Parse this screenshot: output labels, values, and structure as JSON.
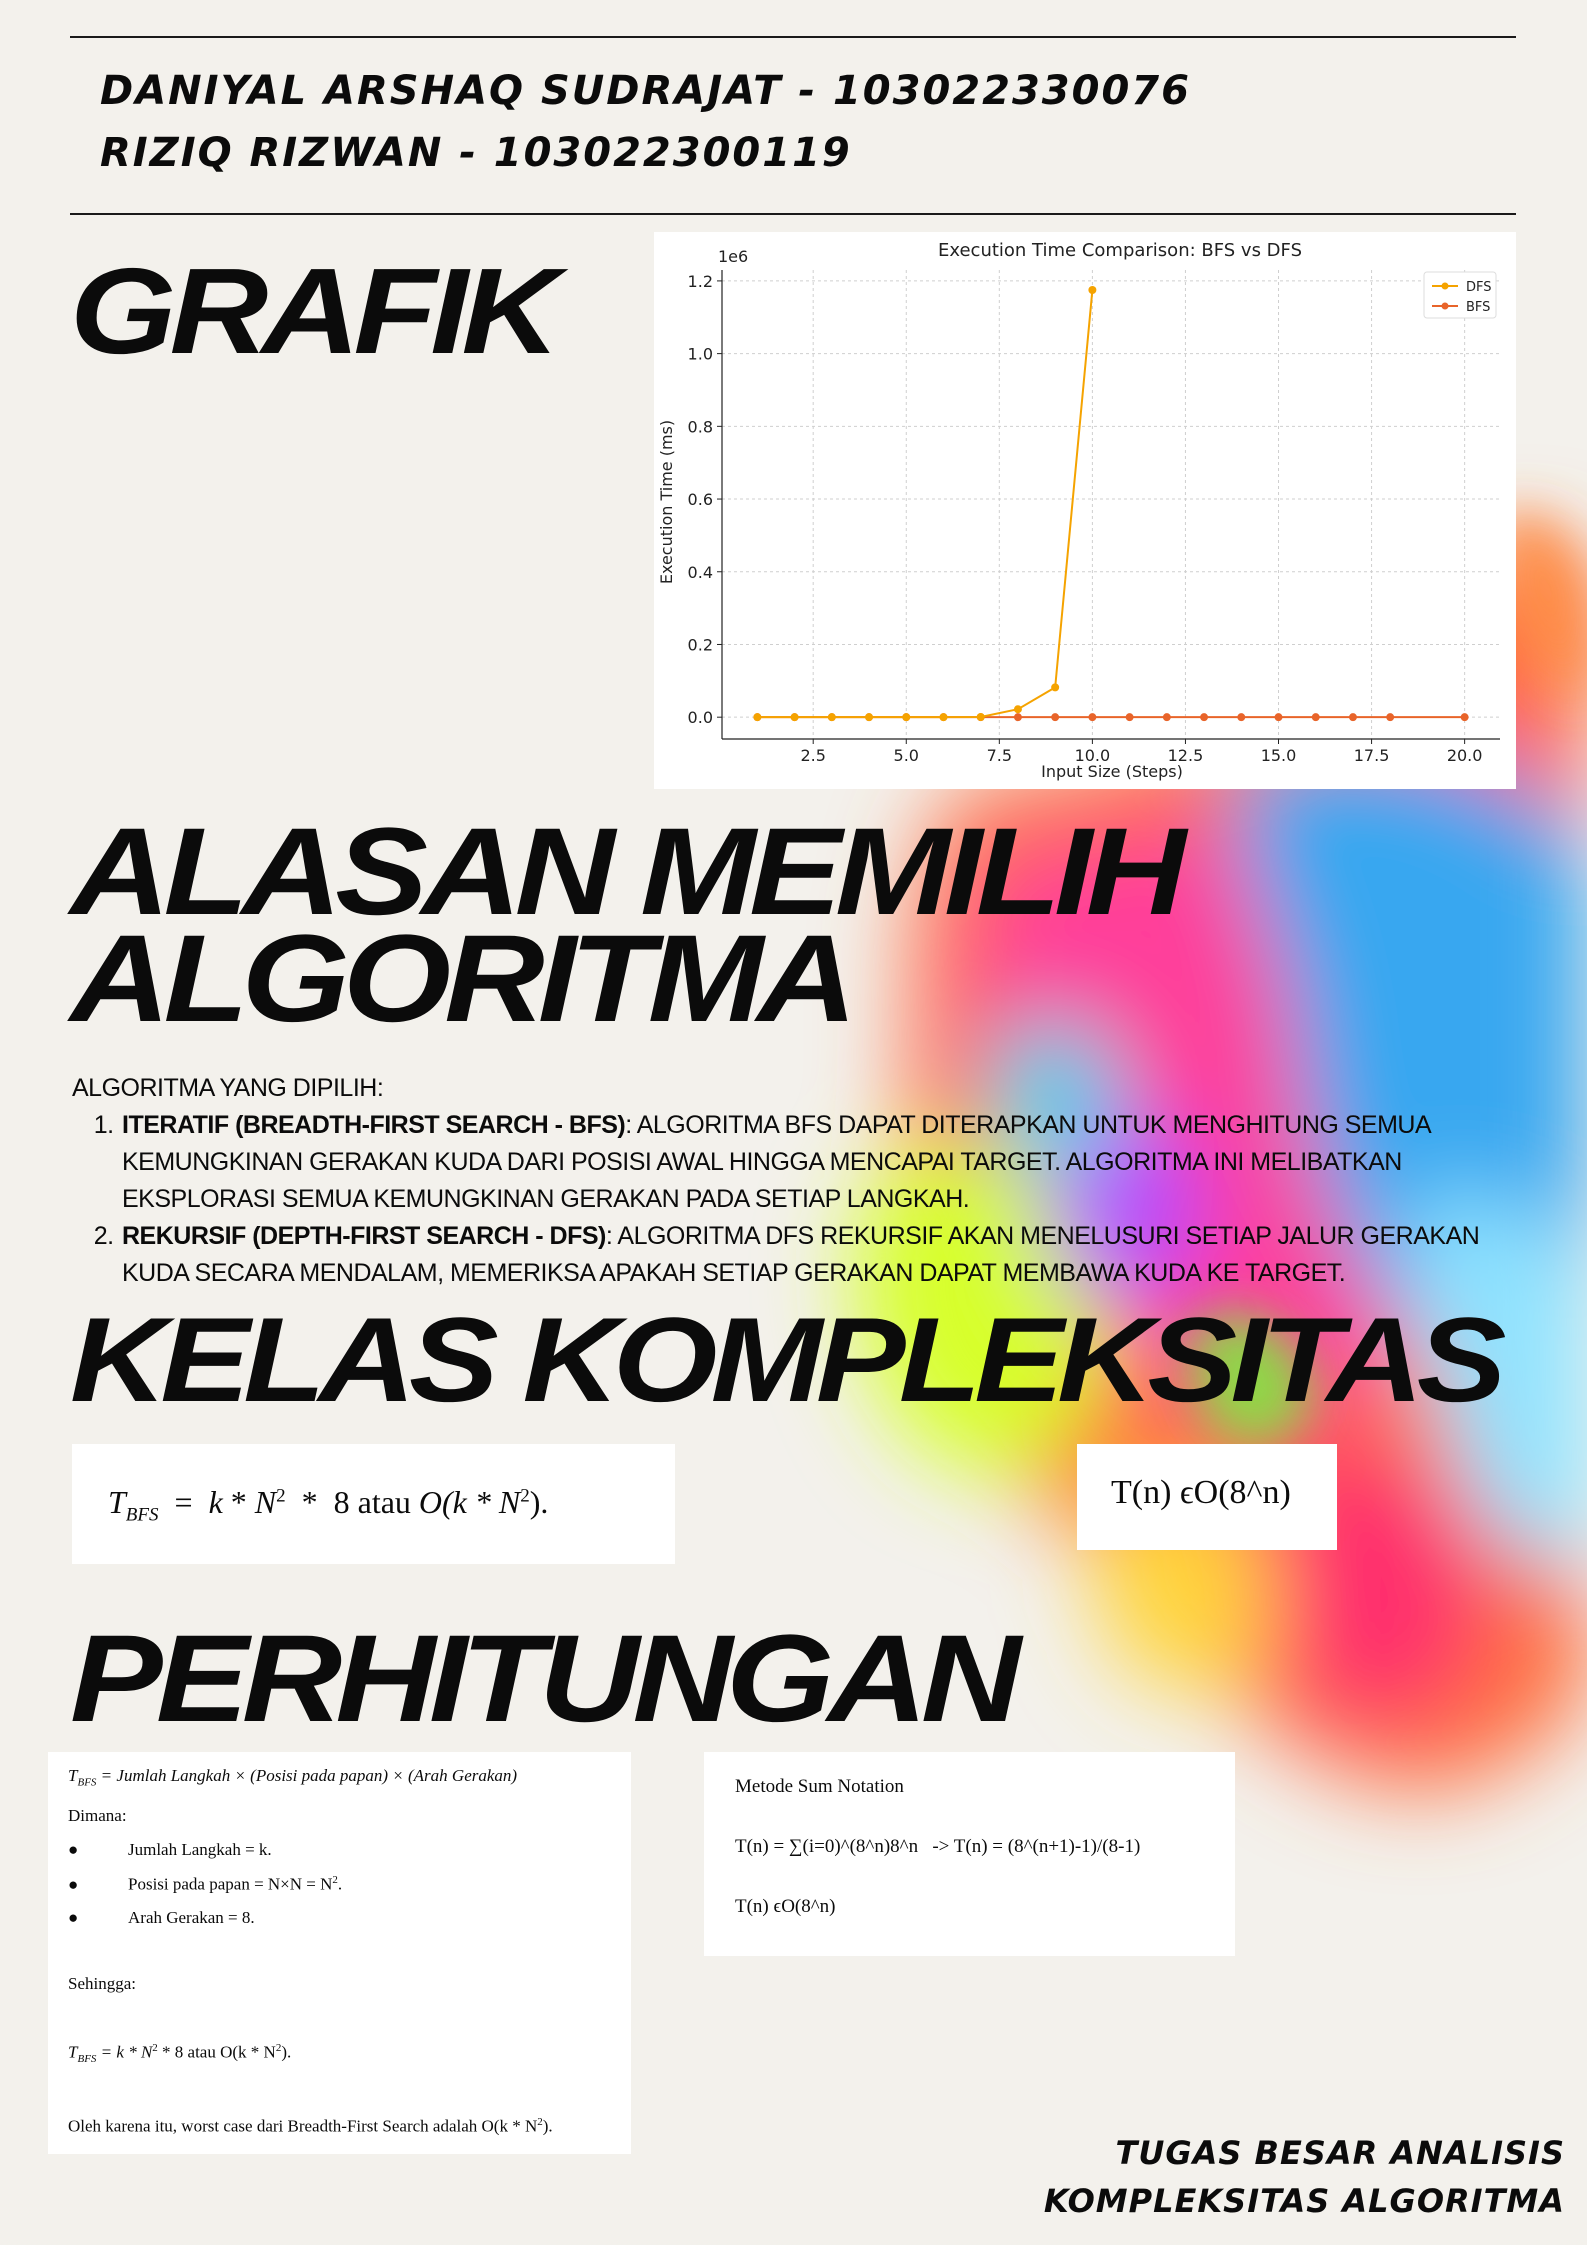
{
  "authors": [
    "DANIYAL ARSHAQ SUDRAJAT - 103022330076",
    "RIZIQ RIZWAN - 103022300119"
  ],
  "sections": {
    "grafik": "GRAFIK",
    "alasan_line1": "ALASAN MEMILIH",
    "alasan_line2": "ALGORITMA",
    "kelas": "KELAS KOMPLEKSITAS",
    "perhitungan": "PERHITUNGAN"
  },
  "algorithms": {
    "intro": "ALGORITMA YANG DIPILIH:",
    "items": [
      {
        "title": "ITERATIF (BREADTH-FIRST SEARCH - BFS)",
        "text": ": ALGORITMA BFS DAPAT DITERAPKAN UNTUK MENGHITUNG SEMUA KEMUNGKINAN GERAKAN KUDA DARI POSISI AWAL HINGGA MENCAPAI TARGET. ALGORITMA INI MELIBATKAN EKSPLORASI SEMUA KEMUNGKINAN GERAKAN PADA SETIAP LANGKAH."
      },
      {
        "title": "REKURSIF (DEPTH-FIRST SEARCH - DFS)",
        "text": ": ALGORITMA DFS REKURSIF AKAN MENELUSURI SETIAP JALUR GERAKAN KUDA SECARA MENDALAM, MEMERIKSA APAKAH SETIAP GERAKAN DAPAT MEMBAWA KUDA KE TARGET."
      }
    ]
  },
  "complexity": {
    "bfs": {
      "t": "T",
      "sub": "BFS",
      "eq": "=",
      "k": "k",
      "star": "*",
      "n": "N",
      "exp": "2",
      "eight": "8 atau",
      "o_open": "O(k * N",
      "o_close": ")."
    },
    "dfs": "T(n) ϵO(8^n)"
  },
  "perhitungan_bfs": {
    "formula_lhs": "T",
    "formula_sub": "BFS",
    "formula_rhs": "=  Jumlah Langkah × (Posisi pada papan) × (Arah Gerakan)",
    "dimana": "Dimana:",
    "bullets": [
      {
        "text": "Jumlah Langkah = k.",
        "sup": ""
      },
      {
        "text": "Posisi pada papan = N×N  =  N",
        "sup": "2",
        "tail": "."
      },
      {
        "text": "Arah Gerakan = 8.",
        "sup": ""
      }
    ],
    "sehingga": "Sehingga:",
    "result_lhs": "T",
    "result_sub": "BFS",
    "result_body": "=  k * N",
    "result_exp": "2",
    "result_tail": "  *  8 atau O(k * N",
    "result_exp2": "2",
    "result_end": ").",
    "conclusion": "Oleh karena itu, worst case dari Breadth-First Search adalah O(k * N",
    "conclusion_exp": "2",
    "conclusion_end": ")."
  },
  "perhitungan_dfs": {
    "title": "Metode Sum Notation",
    "line1": "T(n) = ∑(i=0)^(8^n)8^n   -> T(n) = (8^(n+1)-1)/(8-1)",
    "line2": "T(n) ϵO(8^n)"
  },
  "footer": [
    "TUGAS BESAR ANALISIS",
    "KOMPLEKSITAS ALGORITMA"
  ],
  "chart_data": {
    "type": "line",
    "title": "Execution Time Comparison: BFS vs DFS",
    "xlabel": "Input Size (Steps)",
    "ylabel": "Execution Time (ms)",
    "y_multiplier_label": "1e6",
    "xlim": [
      0.05,
      20.95
    ],
    "ylim": [
      -60000,
      1230000
    ],
    "xticks": [
      2.5,
      5.0,
      7.5,
      10.0,
      12.5,
      15.0,
      17.5,
      20.0
    ],
    "yticks": [
      0.0,
      0.2,
      0.4,
      0.6,
      0.8,
      1.0,
      1.2
    ],
    "grid": true,
    "legend_position": "top-right",
    "series": [
      {
        "name": "DFS",
        "color": "#f5a300",
        "x": [
          1,
          2,
          3,
          4,
          5,
          6,
          7,
          8,
          9,
          10
        ],
        "values": [
          0,
          0,
          0,
          0,
          0,
          10,
          500,
          22000,
          82000,
          1175000
        ]
      },
      {
        "name": "BFS",
        "color": "#e8642a",
        "x": [
          1,
          2,
          3,
          4,
          5,
          6,
          7,
          8,
          9,
          10,
          11,
          12,
          13,
          14,
          15,
          16,
          17,
          18,
          20
        ],
        "values": [
          0,
          0,
          0,
          0,
          0,
          0,
          0,
          0,
          0,
          0,
          0,
          0,
          0,
          0,
          0,
          0,
          0,
          0,
          0
        ]
      }
    ]
  }
}
